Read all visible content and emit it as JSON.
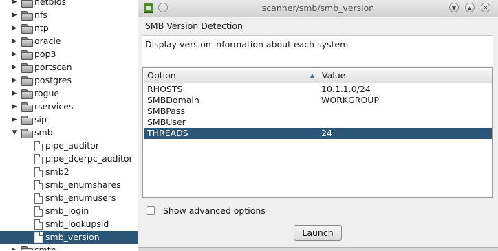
{
  "tree": {
    "items": [
      {
        "label": "netbios",
        "type": "folder",
        "expanded": false
      },
      {
        "label": "nfs",
        "type": "folder",
        "expanded": false
      },
      {
        "label": "ntp",
        "type": "folder",
        "expanded": false
      },
      {
        "label": "oracle",
        "type": "folder",
        "expanded": false
      },
      {
        "label": "pop3",
        "type": "folder",
        "expanded": false
      },
      {
        "label": "portscan",
        "type": "folder",
        "expanded": false
      },
      {
        "label": "postgres",
        "type": "folder",
        "expanded": false
      },
      {
        "label": "rogue",
        "type": "folder",
        "expanded": false
      },
      {
        "label": "rservices",
        "type": "folder",
        "expanded": false
      },
      {
        "label": "sip",
        "type": "folder",
        "expanded": false
      },
      {
        "label": "smb",
        "type": "folder",
        "expanded": true
      },
      {
        "label": "pipe_auditor",
        "type": "file"
      },
      {
        "label": "pipe_dcerpc_auditor",
        "type": "file"
      },
      {
        "label": "smb2",
        "type": "file"
      },
      {
        "label": "smb_enumshares",
        "type": "file"
      },
      {
        "label": "smb_enumusers",
        "type": "file"
      },
      {
        "label": "smb_login",
        "type": "file"
      },
      {
        "label": "smb_lookupsid",
        "type": "file"
      },
      {
        "label": "smb_version",
        "type": "file",
        "selected": true
      },
      {
        "label": "smtp",
        "type": "folder",
        "expanded": false
      }
    ]
  },
  "window": {
    "title": "scanner/smb/smb_version",
    "icon": "app-icon",
    "controls": [
      "minimize-icon",
      "maximize-icon",
      "close-icon"
    ]
  },
  "module": {
    "name": "SMB Version Detection",
    "description": "Display version information about each system"
  },
  "options_table": {
    "headers": {
      "option": "Option",
      "value": "Value"
    },
    "rows": [
      {
        "option": "RHOSTS",
        "value": "10.1.1.0/24"
      },
      {
        "option": "SMBDomain",
        "value": "WORKGROUP"
      },
      {
        "option": "SMBPass",
        "value": ""
      },
      {
        "option": "SMBUser",
        "value": ""
      },
      {
        "option": "THREADS",
        "value": "24",
        "selected": true
      }
    ]
  },
  "advanced": {
    "label": "Show advanced options",
    "checked": false
  },
  "launch_label": "Launch",
  "colors": {
    "selection": "#2b5678"
  }
}
